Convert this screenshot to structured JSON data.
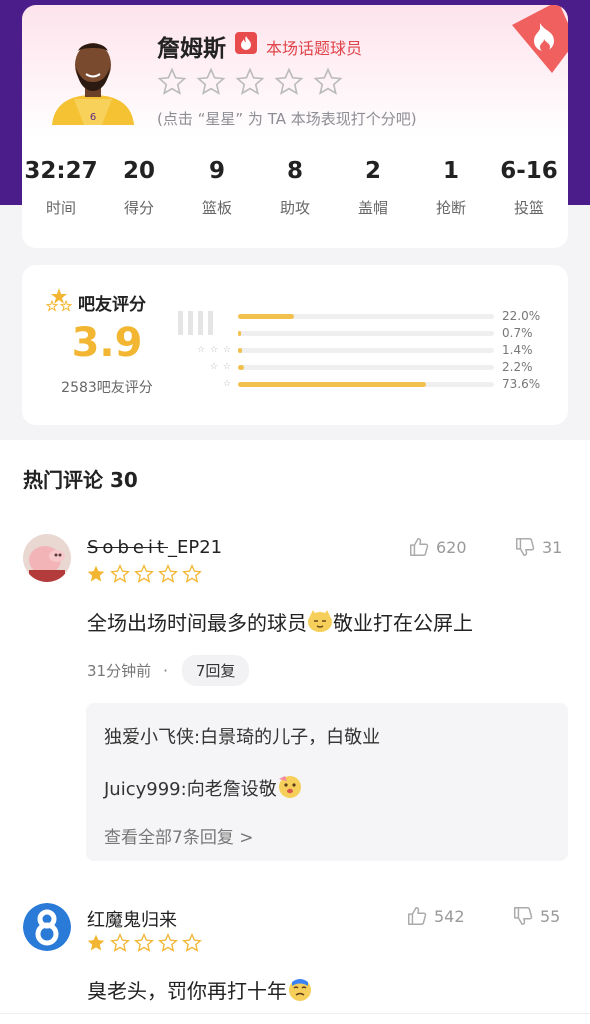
{
  "player": {
    "name": "詹姆斯",
    "topic_label": "本场话题球员",
    "rate_hint": "(点击 “星星” 为 TA 本场表现打个分吧)",
    "jersey_number": "6",
    "stats": [
      {
        "value": "32:27",
        "label": "时间"
      },
      {
        "value": "20",
        "label": "得分"
      },
      {
        "value": "9",
        "label": "篮板"
      },
      {
        "value": "8",
        "label": "助攻"
      },
      {
        "value": "2",
        "label": "盖帽"
      },
      {
        "value": "1",
        "label": "抢断"
      },
      {
        "value": "6-16",
        "label": "投篮"
      }
    ]
  },
  "rating": {
    "title": "吧友评分",
    "score": "3.9",
    "count_text": "2583吧友评分",
    "bars": [
      {
        "stars": "",
        "pct_text": "22.0%",
        "fraction": 0.22
      },
      {
        "stars": "",
        "pct_text": "0.7%",
        "fraction": 0.007
      },
      {
        "stars": "☆ ☆ ☆",
        "pct_text": "1.4%",
        "fraction": 0.014
      },
      {
        "stars": "☆ ☆",
        "pct_text": "2.2%",
        "fraction": 0.022
      },
      {
        "stars": "☆",
        "pct_text": "73.6%",
        "fraction": 0.736
      }
    ]
  },
  "comments": {
    "header": "热门评论 30",
    "items": [
      {
        "name_struck": "Sobeit",
        "name_suffix": "_EP21",
        "stars_filled": 1,
        "likes": "620",
        "dislikes": "31",
        "text": "全场出场时间最多的球员",
        "text_after_emoji": "敬业打在公屏上",
        "time": "31分钟前",
        "dot": "·",
        "reply_chip": "7回复",
        "replies": [
          {
            "user": "独爱小飞侠",
            "text": ":白景琦的儿子，白敬业"
          },
          {
            "user": "Juicy999",
            "text": ":向老詹设敬"
          }
        ],
        "see_all": "查看全部7条回复 >"
      },
      {
        "name": "红魔鬼归来",
        "stars_filled": 1,
        "likes": "542",
        "dislikes": "55",
        "text": "臭老头，罚你再打十年"
      }
    ]
  },
  "colors": {
    "accent_gold": "#f2b632",
    "topic_red": "#e0444a",
    "header_purple": "#4b1d8a"
  }
}
